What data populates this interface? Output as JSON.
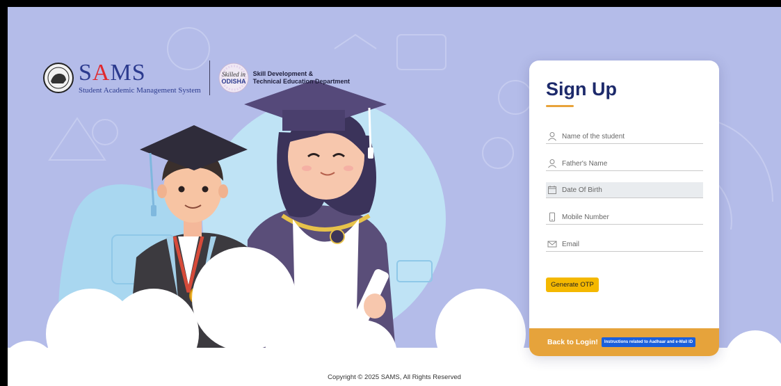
{
  "header": {
    "sams_title_prefix": "S",
    "sams_title_accent": "A",
    "sams_title_suffix": "MS",
    "sams_subtitle": "Student Academic Management System",
    "skill_badge_text": "Skilled in ODISHA",
    "department_line1": "Skill Development &",
    "department_line2": "Technical Education Department"
  },
  "form": {
    "title": "Sign Up",
    "fields": [
      {
        "placeholder": "Name of the student",
        "icon": "user-icon"
      },
      {
        "placeholder": "Father's Name",
        "icon": "user-icon"
      },
      {
        "placeholder": "Date Of Birth",
        "icon": "calendar-icon"
      },
      {
        "placeholder": "Mobile Number",
        "icon": "mobile-icon"
      },
      {
        "placeholder": "Email",
        "icon": "envelope-icon"
      }
    ],
    "generate_otp_label": "Generate OTP",
    "back_to_login_label": "Back to Login!",
    "instructions_label": "Instructions related to Aadhaar and e-Mail ID"
  },
  "footer": {
    "copyright": "Copyright © 2025 SAMS, All Rights Reserved"
  },
  "colors": {
    "background": "#b4bce9",
    "title": "#1d2a6b",
    "accent_orange": "#e6a33b",
    "otp_button": "#f4b800",
    "instructions_button": "#1a5fdc"
  }
}
